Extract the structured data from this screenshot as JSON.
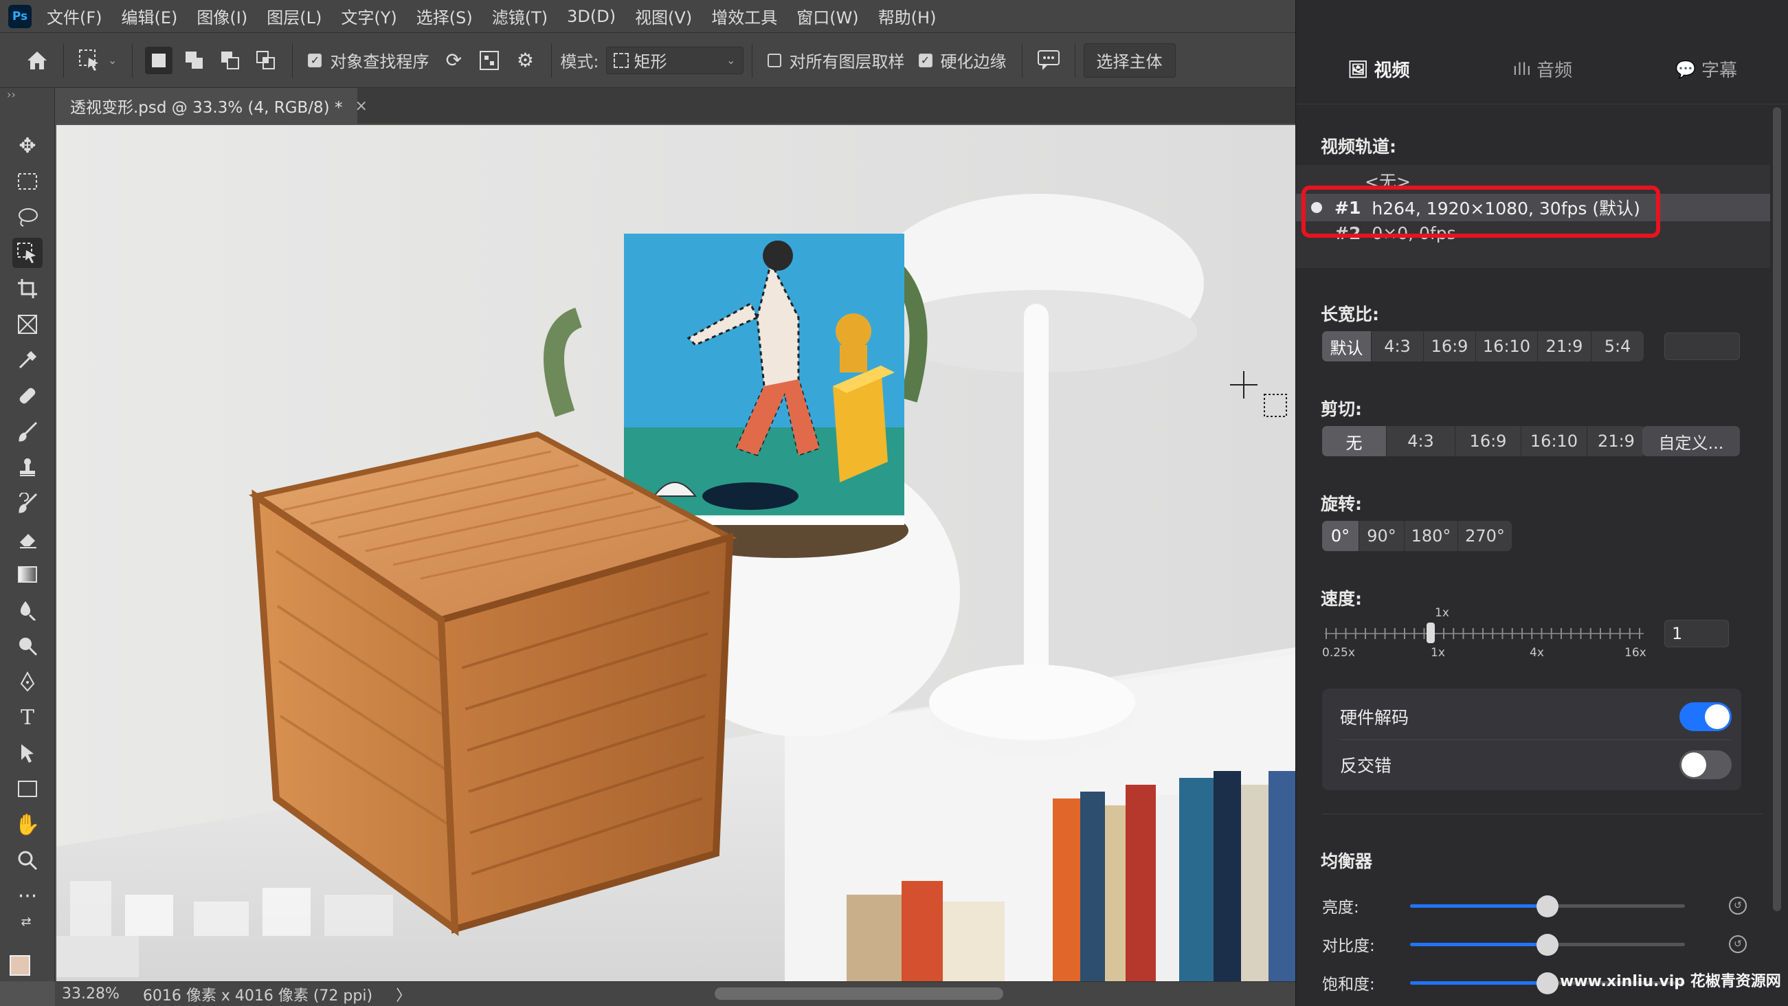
{
  "app": {
    "logo": "Ps"
  },
  "menu": [
    "文件(F)",
    "编辑(E)",
    "图像(I)",
    "图层(L)",
    "文字(Y)",
    "选择(S)",
    "滤镜(T)",
    "3D(D)",
    "视图(V)",
    "增效工具",
    "窗口(W)",
    "帮助(H)"
  ],
  "options": {
    "object_finder": "对象查找程序",
    "mode_label": "模式:",
    "mode_value": "矩形",
    "sample_all": "对所有图层取样",
    "hard_edge": "硬化边缘",
    "select_subject": "选择主体"
  },
  "document": {
    "tab_title": "透视变形.psd @ 33.3% (4, RGB/8) *",
    "close": "×"
  },
  "status": {
    "zoom": "33.28%",
    "info": "6016 像素 x 4016 像素 (72 ppi)",
    "arrow": "〉"
  },
  "panel": {
    "tabs": [
      {
        "icon": "🖼",
        "label": "视频"
      },
      {
        "icon": "ıllı",
        "label": "音频"
      },
      {
        "icon": "💬",
        "label": "字幕"
      }
    ],
    "video_track_label": "视频轨道:",
    "tracks": [
      "<无>",
      "#1",
      "h264, 1920×1080, 30fps (默认)",
      "#2",
      "0×0, 0fps"
    ],
    "aspect_label": "长宽比:",
    "aspect_options": [
      "默认",
      "4:3",
      "16:9",
      "16:10",
      "21:9",
      "5:4"
    ],
    "crop_label": "剪切:",
    "crop_options": [
      "无",
      "4:3",
      "16:9",
      "16:10",
      "21:9"
    ],
    "crop_custom": "自定义...",
    "rotate_label": "旋转:",
    "rotate_options": [
      "0°",
      "90°",
      "180°",
      "270°"
    ],
    "speed_label": "速度:",
    "speed_marker": "1x",
    "speed_ticks": [
      "0.25x",
      "1x",
      "4x",
      "16x"
    ],
    "speed_value": "1",
    "hw_decode": "硬件解码",
    "hw_decode_on": true,
    "deinterlace": "反交错",
    "deinterlace_on": false,
    "eq_label": "均衡器",
    "eq_rows": [
      {
        "label": "亮度:",
        "level": 0.5
      },
      {
        "label": "对比度:",
        "level": 0.5
      },
      {
        "label": "饱和度:",
        "level": 0.5
      }
    ],
    "accent": "#1f74ff",
    "highlight": "#e8131f"
  },
  "watermark": "www.xinliu.vip 花椒青资源网"
}
